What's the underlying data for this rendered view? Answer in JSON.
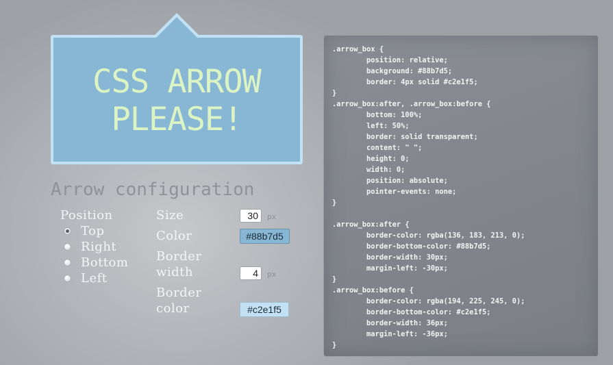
{
  "preview": {
    "text_line1": "CSS ARROW",
    "text_line2": "PLEASE!"
  },
  "config": {
    "title": "Arrow configuration",
    "position": {
      "label": "Position",
      "options": [
        "Top",
        "Right",
        "Bottom",
        "Left"
      ],
      "selected": "Top"
    },
    "size": {
      "label": "Size",
      "value": "30",
      "unit": "px"
    },
    "color": {
      "label": "Color",
      "value": "#88b7d5"
    },
    "border_width": {
      "label_line1": "Border",
      "label_line2": "width",
      "value": "4",
      "unit": "px"
    },
    "border_color": {
      "label_line1": "Border",
      "label_line2": "color",
      "value": "#c2e1f5"
    }
  },
  "colors": {
    "box_background": "#88b7d5",
    "box_border": "#c2e1f5",
    "preview_text": "#dcf3c4"
  },
  "code": ".arrow_box {\n\tposition: relative;\n\tbackground: #88b7d5;\n\tborder: 4px solid #c2e1f5;\n}\n.arrow_box:after, .arrow_box:before {\n\tbottom: 100%;\n\tleft: 50%;\n\tborder: solid transparent;\n\tcontent: \" \";\n\theight: 0;\n\twidth: 0;\n\tposition: absolute;\n\tpointer-events: none;\n}\n\n.arrow_box:after {\n\tborder-color: rgba(136, 183, 213, 0);\n\tborder-bottom-color: #88b7d5;\n\tborder-width: 30px;\n\tmargin-left: -30px;\n}\n.arrow_box:before {\n\tborder-color: rgba(194, 225, 245, 0);\n\tborder-bottom-color: #c2e1f5;\n\tborder-width: 36px;\n\tmargin-left: -36px;\n}"
}
